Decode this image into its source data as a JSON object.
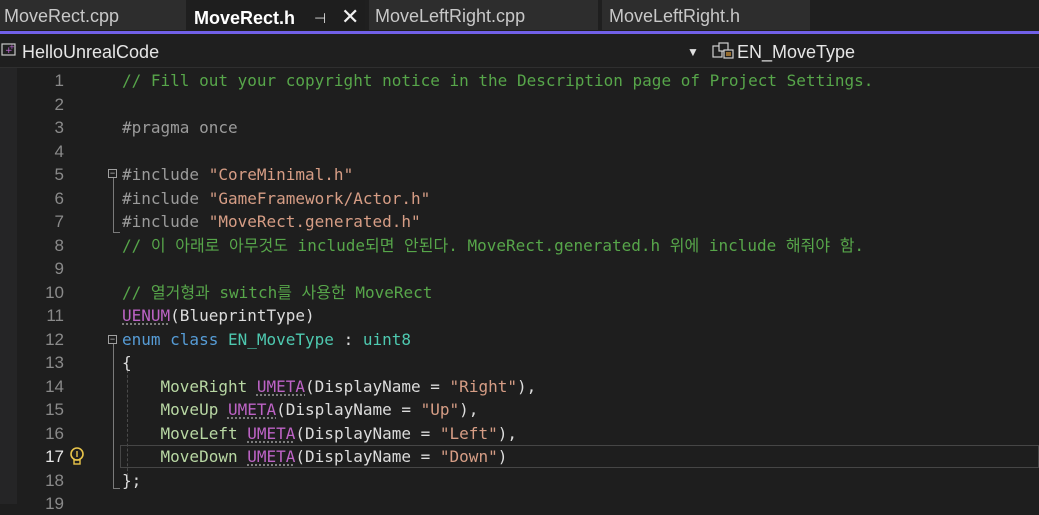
{
  "tabs": [
    {
      "label": "MoveRect.cpp",
      "active": false
    },
    {
      "label": "MoveRect.h",
      "active": true
    },
    {
      "label": "MoveLeftRight.cpp",
      "active": false
    },
    {
      "label": "MoveLeftRight.h",
      "active": false
    }
  ],
  "tab_icons": {
    "pin": "pin-icon",
    "close": "close-icon"
  },
  "navbar": {
    "project": "HelloUnrealCode",
    "project_icon": "project-icon",
    "scope": "EN_MoveType",
    "scope_icon": "enum-type-icon"
  },
  "colors": {
    "accent": "#7160e8",
    "comment": "#57a64a",
    "keyword": "#569cd6",
    "type": "#4ec9b0",
    "string": "#d69d85",
    "macro": "#bd63c5",
    "enum_member": "#b8d7a3"
  },
  "editor": {
    "current_line": 17,
    "lines": [
      {
        "n": "1",
        "tokens": [
          {
            "t": "// Fill out your copyright notice in the Description page of Project Settings.",
            "c": "comment"
          }
        ]
      },
      {
        "n": "2",
        "tokens": []
      },
      {
        "n": "3",
        "tokens": [
          {
            "t": "#pragma once",
            "c": "pre"
          }
        ]
      },
      {
        "n": "4",
        "tokens": []
      },
      {
        "n": "5",
        "tokens": [
          {
            "t": "#include ",
            "c": "pre"
          },
          {
            "t": "\"CoreMinimal.h\"",
            "c": "str"
          }
        ]
      },
      {
        "n": "6",
        "tokens": [
          {
            "t": "#include ",
            "c": "pre"
          },
          {
            "t": "\"GameFramework/Actor.h\"",
            "c": "str"
          }
        ]
      },
      {
        "n": "7",
        "tokens": [
          {
            "t": "#include ",
            "c": "pre"
          },
          {
            "t": "\"MoveRect.generated.h\"",
            "c": "str"
          }
        ]
      },
      {
        "n": "8",
        "tokens": [
          {
            "t": "// 이 아래로 아무것도 include되면 안된다. MoveRect.generated.h 위에 include 해줘야 함.",
            "c": "comment"
          }
        ]
      },
      {
        "n": "9",
        "tokens": []
      },
      {
        "n": "10",
        "tokens": [
          {
            "t": "// 열거형과 switch를 사용한 MoveRect",
            "c": "comment"
          }
        ]
      },
      {
        "n": "11",
        "tokens": [
          {
            "t": "UENUM",
            "c": "macro",
            "sq": true
          },
          {
            "t": "(BlueprintType)",
            "c": "plain"
          }
        ]
      },
      {
        "n": "12",
        "tokens": [
          {
            "t": "enum class ",
            "c": "kw"
          },
          {
            "t": "EN_MoveType",
            "c": "type"
          },
          {
            "t": " : ",
            "c": "plain"
          },
          {
            "t": "uint8",
            "c": "type"
          }
        ]
      },
      {
        "n": "13",
        "tokens": [
          {
            "t": "{",
            "c": "plain"
          }
        ]
      },
      {
        "n": "14",
        "tokens": [
          {
            "t": "    ",
            "c": "plain"
          },
          {
            "t": "MoveRight",
            "c": "enum"
          },
          {
            "t": " ",
            "c": "plain"
          },
          {
            "t": "UMETA",
            "c": "macro",
            "sq": true
          },
          {
            "t": "(DisplayName = ",
            "c": "plain"
          },
          {
            "t": "\"Right\"",
            "c": "str"
          },
          {
            "t": "),",
            "c": "plain"
          }
        ]
      },
      {
        "n": "15",
        "tokens": [
          {
            "t": "    ",
            "c": "plain"
          },
          {
            "t": "MoveUp",
            "c": "enum"
          },
          {
            "t": " ",
            "c": "plain"
          },
          {
            "t": "UMETA",
            "c": "macro",
            "sq": true
          },
          {
            "t": "(DisplayName = ",
            "c": "plain"
          },
          {
            "t": "\"Up\"",
            "c": "str"
          },
          {
            "t": "),",
            "c": "plain"
          }
        ]
      },
      {
        "n": "16",
        "tokens": [
          {
            "t": "    ",
            "c": "plain"
          },
          {
            "t": "MoveLeft",
            "c": "enum"
          },
          {
            "t": " ",
            "c": "plain"
          },
          {
            "t": "UMETA",
            "c": "macro",
            "sq": true
          },
          {
            "t": "(DisplayName = ",
            "c": "plain"
          },
          {
            "t": "\"Left\"",
            "c": "str"
          },
          {
            "t": "),",
            "c": "plain"
          }
        ]
      },
      {
        "n": "17",
        "tokens": [
          {
            "t": "    ",
            "c": "plain"
          },
          {
            "t": "MoveDown",
            "c": "enum"
          },
          {
            "t": " ",
            "c": "plain"
          },
          {
            "t": "UMETA",
            "c": "macro",
            "sq": true
          },
          {
            "t": "(DisplayName = ",
            "c": "plain"
          },
          {
            "t": "\"Down\"",
            "c": "str"
          },
          {
            "t": ")",
            "c": "plain"
          }
        ]
      },
      {
        "n": "18",
        "tokens": [
          {
            "t": "};",
            "c": "plain"
          }
        ]
      },
      {
        "n": "19",
        "tokens": []
      }
    ]
  }
}
